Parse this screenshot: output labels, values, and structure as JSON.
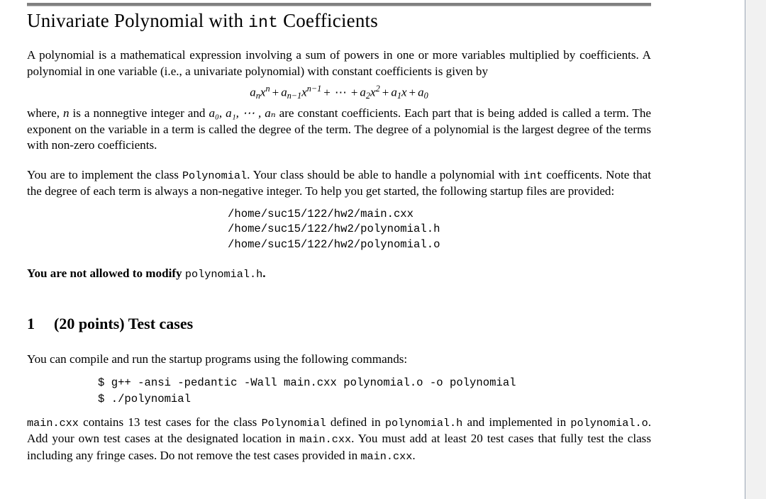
{
  "document": {
    "title_prefix": "Univariate Polynomial with ",
    "title_mono": "int",
    "title_suffix": " Coefficients",
    "paragraph_1": "A polynomial is a mathematical expression involving a sum of powers in one or more variables multiplied by coefficients. A polynomial in one variable (i.e., a univariate polynomial) with constant coefficients is given by",
    "formula": {
      "terms": [
        {
          "coef": "a",
          "coef_sub": "n",
          "var": "x",
          "var_sup": "n"
        },
        {
          "coef": "a",
          "coef_sub": "n−1",
          "var": "x",
          "var_sup": "n−1"
        },
        {
          "ellipsis": "⋯"
        },
        {
          "coef": "a",
          "coef_sub": "2",
          "var": "x",
          "var_sup": "2"
        },
        {
          "coef": "a",
          "coef_sub": "1",
          "var": "x",
          "var_sup": ""
        },
        {
          "coef": "a",
          "coef_sub": "0",
          "var": "",
          "var_sup": ""
        }
      ],
      "operator": "+",
      "plain": "a_n x^n + a_{n-1} x^{n-1} + ⋯ + a_2 x^2 + a_1 x + a_0"
    },
    "paragraph_2_a": "where, ",
    "paragraph_2_n": "n",
    "paragraph_2_b": " is a nonnegtive integer and ",
    "paragraph_2_coefs": "a₀, a₁, ⋯ , aₙ",
    "paragraph_2_c": " are constant coefficients. Each part that is being added is called a term. The exponent on the variable in a term is called the degree of the term. The degree of a polynomial is the largest degree of the terms with non-zero coefficients.",
    "paragraph_3_a": "You are to implement the class ",
    "paragraph_3_class": "Polynomial",
    "paragraph_3_b": ". Your class should be able to handle a polynomial with ",
    "paragraph_3_type": "int",
    "paragraph_3_c": " coefficents. Note that the degree of each term is always a non-negative integer. To help you get started, the following startup files are provided:",
    "files": [
      "/home/suc15/122/hw2/main.cxx",
      "/home/suc15/122/hw2/polynomial.h",
      "/home/suc15/122/hw2/polynomial.o"
    ],
    "bold_note_text": "You are not allowed to modify ",
    "bold_note_mono": "polynomial.h",
    "bold_note_end": ".",
    "section": {
      "number": "1",
      "title": "(20 points) Test cases"
    },
    "paragraph_4": "You can compile and run the startup programs using the following commands:",
    "commands": [
      "$ g++ -ansi -pedantic -Wall main.cxx polynomial.o -o polynomial",
      "$ ./polynomial"
    ],
    "paragraph_5_a": "main.cxx",
    "paragraph_5_b": " contains 13 test cases for the class ",
    "paragraph_5_c": "Polynomial",
    "paragraph_5_d": " defined in ",
    "paragraph_5_e": "polynomial.h",
    "paragraph_5_f": " and implemented in ",
    "paragraph_5_g": "polynomial.o",
    "paragraph_5_h": ". Add your own test cases at the designated location in ",
    "paragraph_5_i": "main.cxx",
    "paragraph_5_j": ". You must add at least 20 test cases that fully test the class including any fringe cases. Do not remove the test cases provided in ",
    "paragraph_5_k": "main.cxx",
    "paragraph_5_l": "."
  },
  "colors": {
    "page_background": "#ffffff",
    "text": "#000000",
    "top_rule": "#808080",
    "divider": "#9aa5b4",
    "scrollbar_track": "#f1f1f1"
  }
}
